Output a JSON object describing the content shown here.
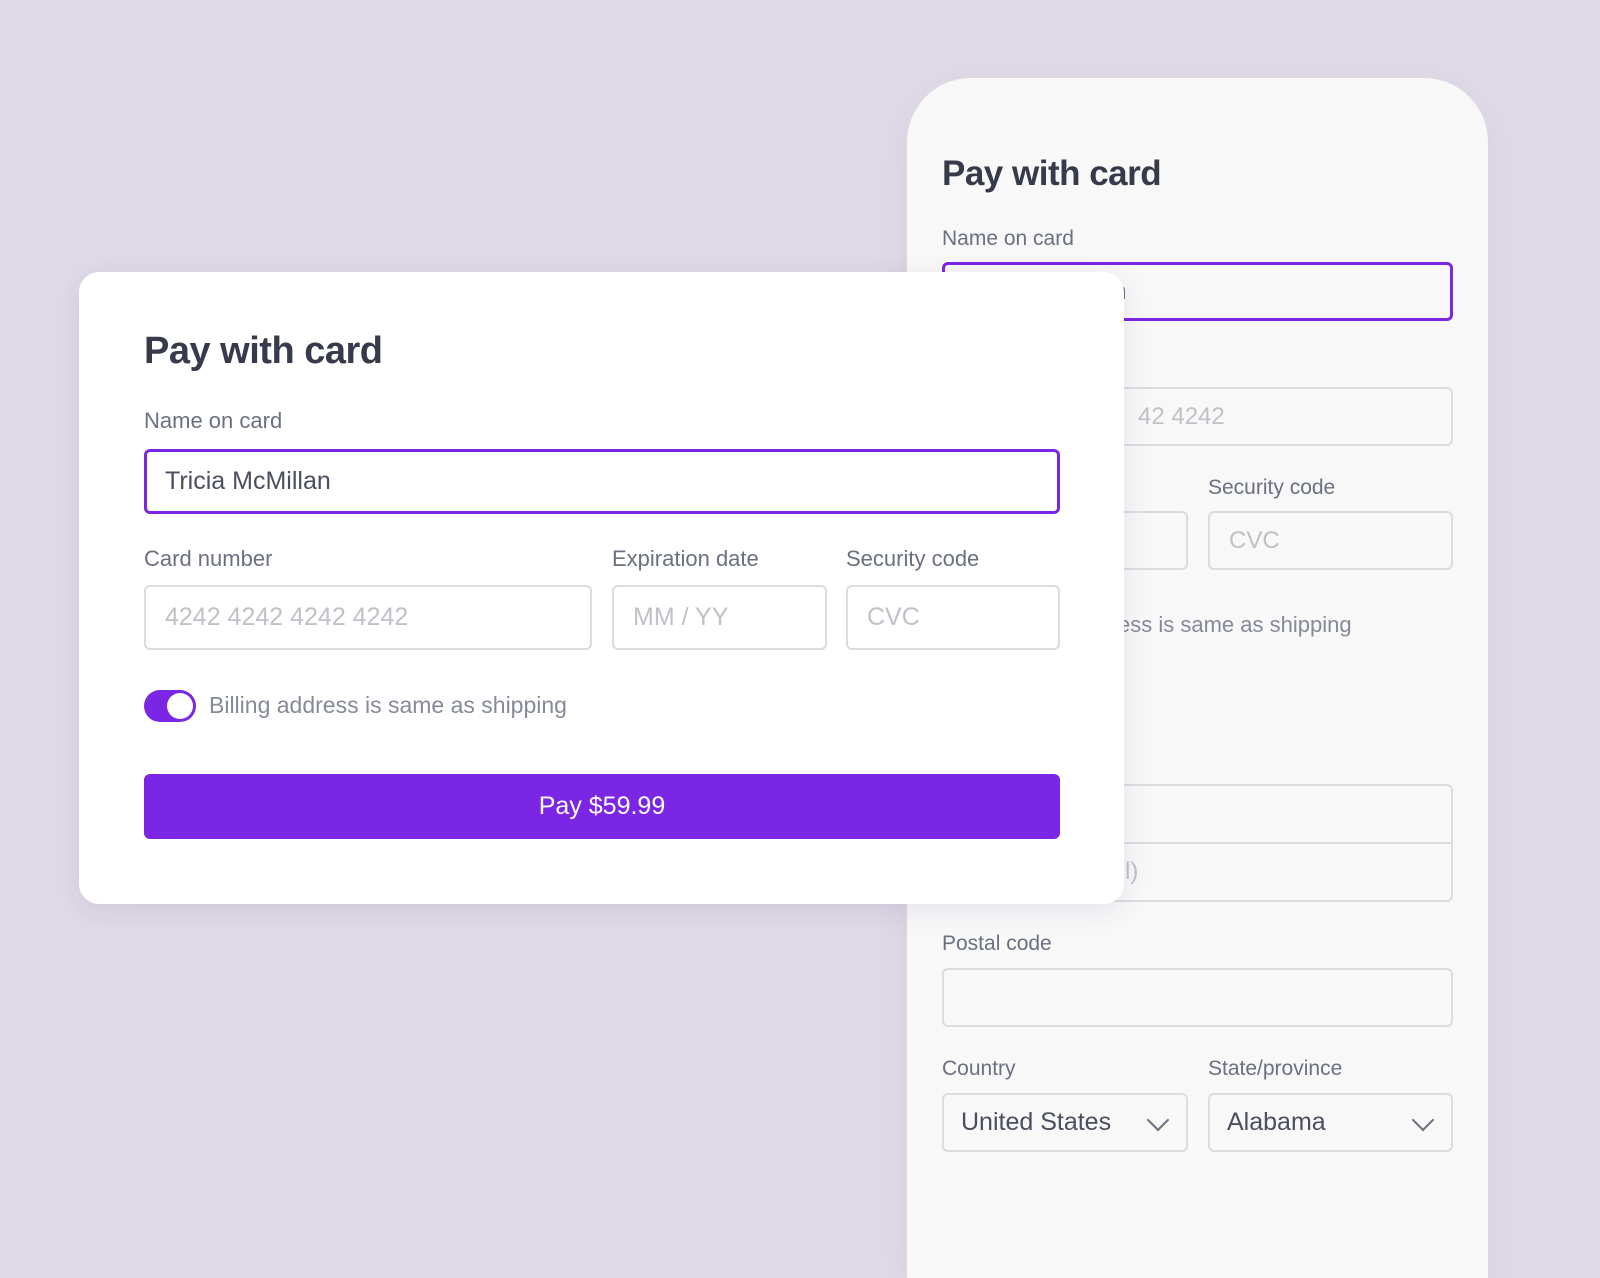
{
  "colors": {
    "accent": "#7b26e4",
    "background": "#dfdae6"
  },
  "front_form": {
    "title": "Pay with card",
    "name_label": "Name on card",
    "name_value": "Tricia McMillan",
    "card_number_label": "Card number",
    "card_number_placeholder": "4242 4242 4242 4242",
    "expiration_label": "Expiration date",
    "expiration_placeholder": "MM / YY",
    "security_label": "Security code",
    "security_placeholder": "CVC",
    "billing_toggle_label": "Billing address is same as shipping",
    "billing_toggle_on": true,
    "pay_button": "Pay $59.99"
  },
  "back_form": {
    "title": "Pay with card",
    "name_label": "Name on card",
    "name_value_fragment": "n",
    "card_number_fragment": "42 4242",
    "security_label": "Security code",
    "security_placeholder": "CVC",
    "billing_fragment": "ess is same as shipping",
    "address_line2_fragment": "l)",
    "postal_label": "Postal code",
    "postal_value": "",
    "country_label": "Country",
    "country_value": "United States",
    "state_label": "State/province",
    "state_value": "Alabama"
  }
}
